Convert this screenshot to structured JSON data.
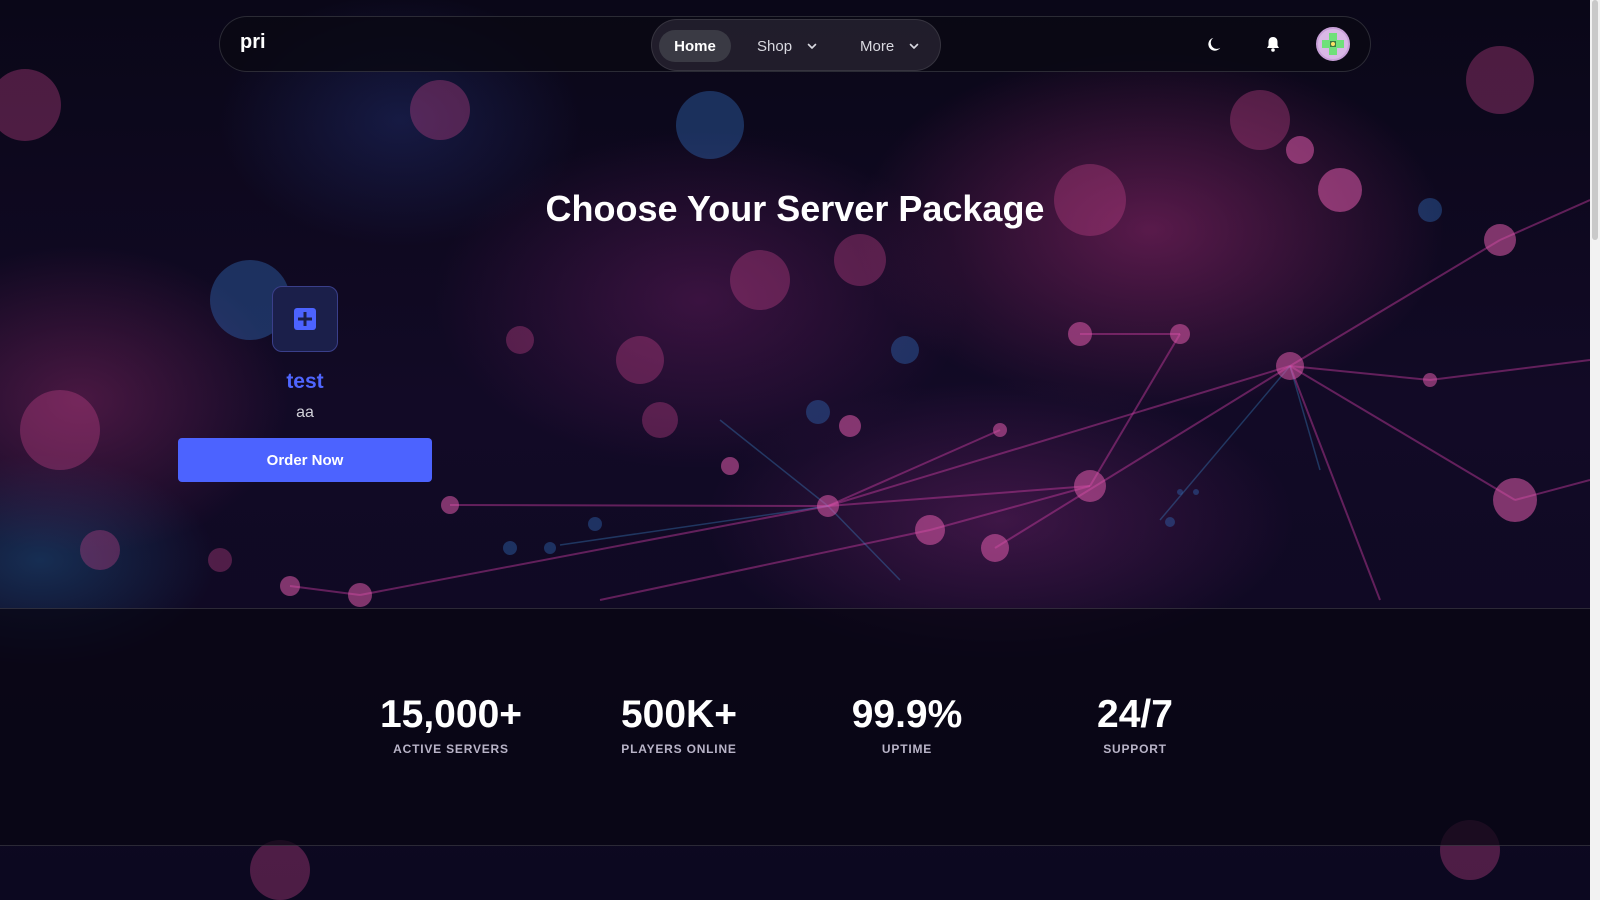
{
  "navbar": {
    "brand": "pri",
    "items": [
      {
        "label": "Home",
        "active": true
      },
      {
        "label": "Shop",
        "has_dropdown": true
      },
      {
        "label": "More",
        "has_dropdown": true
      }
    ],
    "icons": [
      "moon-icon",
      "bell-icon",
      "avatar"
    ]
  },
  "hero": {
    "title": "Choose Your Server Package"
  },
  "packages": [
    {
      "icon": "plus-square-icon",
      "name": "test",
      "description": "aa",
      "button_label": "Order Now"
    }
  ],
  "stats": [
    {
      "value": "15,000+",
      "label": "ACTIVE SERVERS"
    },
    {
      "value": "500K+",
      "label": "PLAYERS ONLINE"
    },
    {
      "value": "99.9%",
      "label": "UPTIME"
    },
    {
      "value": "24/7",
      "label": "SUPPORT"
    }
  ],
  "colors": {
    "accent": "#4c63ff",
    "package_name": "#4f66ff",
    "background": "#0c0820"
  }
}
